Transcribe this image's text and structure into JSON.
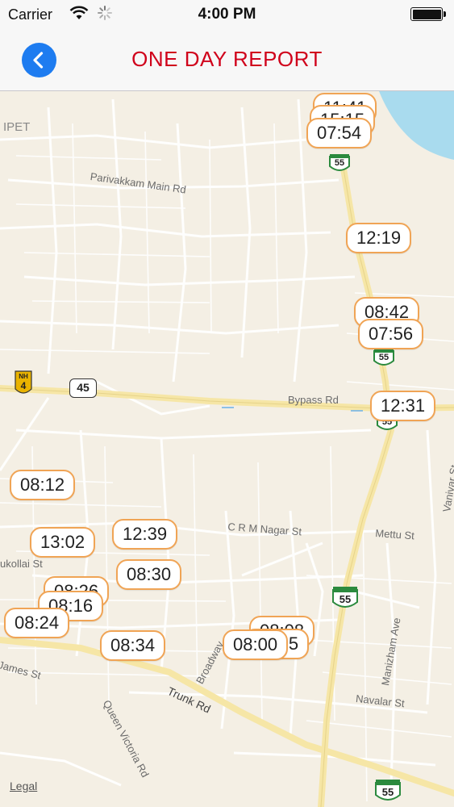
{
  "status_bar": {
    "carrier": "Carrier",
    "time": "4:00 PM"
  },
  "header": {
    "title": "ONE DAY REPORT"
  },
  "map": {
    "labels": {
      "area": "IPET",
      "parivakkam": "Parivakkam Main Rd",
      "bypass": "Bypass Rd",
      "crm": "C R M Nagar St",
      "mettu": "Mettu St",
      "vanivar": "Vanivar St",
      "manizham": "Manizham Ave",
      "navalar": "Navalar St",
      "trunk": "Trunk Rd",
      "queen": "Queen Victoria Rd",
      "james": "James St",
      "ukollai": "ukollai St",
      "broad": "Broadway"
    },
    "shields": {
      "nh_top": "NH",
      "nh_num": "4",
      "route45": "45",
      "route55": "55"
    },
    "legal": "Legal",
    "markers": [
      {
        "time": "11:41"
      },
      {
        "time": "15:15"
      },
      {
        "time": "07:54"
      },
      {
        "time": "12:19"
      },
      {
        "time": "08:42"
      },
      {
        "time": "07:56"
      },
      {
        "time": "12:31"
      },
      {
        "time": "08:12"
      },
      {
        "time": "12:39"
      },
      {
        "time": "13:02"
      },
      {
        "time": "08:30"
      },
      {
        "time": "08:26"
      },
      {
        "time": "08:16"
      },
      {
        "time": "08:24"
      },
      {
        "time": "08:34"
      },
      {
        "time": "08:08"
      },
      {
        "time": "08:05"
      },
      {
        "time": "08:00"
      }
    ]
  },
  "colors": {
    "accent": "#1e7cf0",
    "title": "#d0021b",
    "marker_border": "#f0a455",
    "map_bg": "#f4efe4"
  }
}
